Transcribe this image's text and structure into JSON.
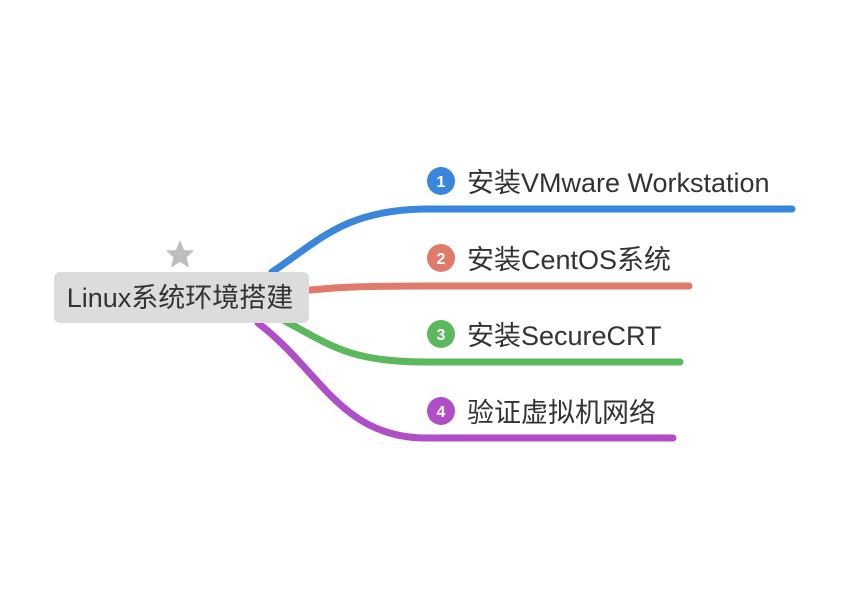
{
  "mindmap": {
    "root": {
      "label": "Linux系统环境搭建",
      "marker_icon": "star-icon",
      "marker_color": "#bdbdbd",
      "fill_color": "#dcdcdc"
    },
    "branches": [
      {
        "number": "1",
        "label": "安装VMware Workstation",
        "color": "#3a86dc"
      },
      {
        "number": "2",
        "label": "安装CentOS系统",
        "color": "#e07b6c"
      },
      {
        "number": "3",
        "label": "安装SecureCRT",
        "color": "#5cb85c"
      },
      {
        "number": "4",
        "label": "验证虚拟机网络",
        "color": "#b04ec8"
      }
    ]
  }
}
